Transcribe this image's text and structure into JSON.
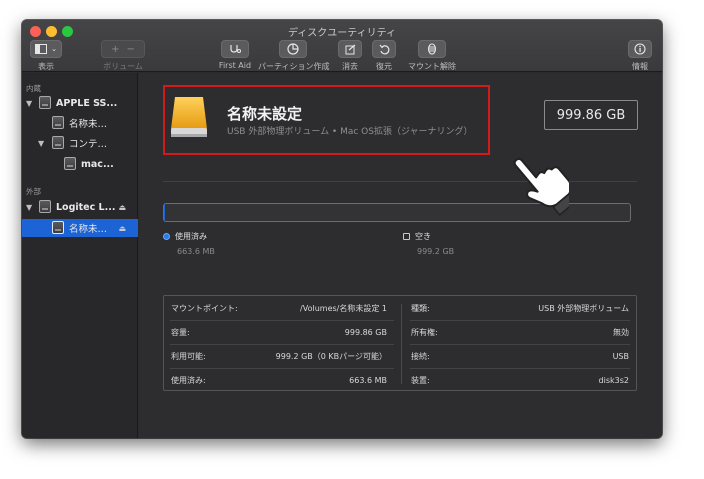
{
  "window": {
    "title": "ディスクユーティリティ"
  },
  "toolbar": {
    "view_label": "表示",
    "volume_label": "ボリューム",
    "first_aid_label": "First Aid",
    "partition_label": "パーティション作成",
    "erase_label": "消去",
    "restore_label": "復元",
    "unmount_label": "マウント解除",
    "info_label": "情報"
  },
  "sidebar": {
    "internal_header": "内蔵",
    "external_header": "外部",
    "items": [
      {
        "label": "APPLE SS..."
      },
      {
        "label": "名称未…"
      },
      {
        "label": "コンテ…"
      },
      {
        "label": "mac..."
      },
      {
        "label": "Logitec L..."
      },
      {
        "label": "名称未…"
      }
    ]
  },
  "volume": {
    "name": "名称未設定",
    "description": "USB 外部物理ボリューム • Mac OS拡張（ジャーナリング）",
    "capacity": "999.86 GB"
  },
  "usage": {
    "used_fraction": 0.0007,
    "used_label": "使用済み",
    "used_value": "663.6 MB",
    "free_label": "空き",
    "free_value": "999.2 GB"
  },
  "info": {
    "left": [
      {
        "key": "マウントポイント:",
        "value": "/Volumes/名称未設定 1"
      },
      {
        "key": "容量:",
        "value": "999.86 GB"
      },
      {
        "key": "利用可能:",
        "value": "999.2 GB（0 KBパージ可能）"
      },
      {
        "key": "使用済み:",
        "value": "663.6 MB"
      }
    ],
    "right": [
      {
        "key": "種類:",
        "value": "USB 外部物理ボリューム"
      },
      {
        "key": "所有権:",
        "value": "無効"
      },
      {
        "key": "接続:",
        "value": "USB"
      },
      {
        "key": "装置:",
        "value": "disk3s2"
      }
    ]
  },
  "colors": {
    "accent": "#1c64d6",
    "highlight": "#d11a1a",
    "volume_icon": "#f0a81e"
  }
}
